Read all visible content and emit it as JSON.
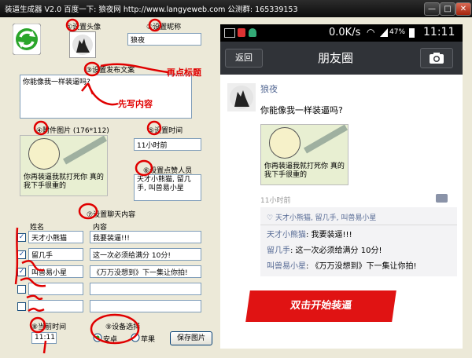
{
  "window": {
    "title": "装逼生成器 V2.0    百度一下: 狼夜网  http://www.langyeweb.com  公测群: 165339153",
    "min_label": "—",
    "max_label": "□",
    "close_label": "✕"
  },
  "left": {
    "avatar_label": "①设置头像",
    "nickname_label": "②设置昵称",
    "nickname_value": "狼夜",
    "post_text_label": "③设置发布文案",
    "post_text_value": "你能像我一样装逼吗?",
    "image_label": "④附件图片 (176*112)",
    "time_label": "⑤设置时间",
    "time_value": "11小时前",
    "likes_label": "⑥设置点赞人员",
    "likes_value": "天才小熊猫, 留几手, 叫兽易小星",
    "comments_label": "⑦设置聊天内容",
    "col_name": "姓名",
    "col_content": "内容",
    "comments": [
      {
        "checked": true,
        "name": "天才小熊猫",
        "content": "我要装逼!!!"
      },
      {
        "checked": true,
        "name": "留几手",
        "content": "这一次必须给满分 10分!"
      },
      {
        "checked": true,
        "name": "叫兽易小星",
        "content": "《万万没想到》下一集让你拍!"
      },
      {
        "checked": false,
        "name": "",
        "content": ""
      },
      {
        "checked": false,
        "name": "",
        "content": ""
      }
    ],
    "current_time_label": "⑧当前时间",
    "current_time_value": "11:11",
    "device_label": "⑨设备选择",
    "device_android": "安卓",
    "device_apple": "苹果",
    "device_selected": "android",
    "save_button": "保存图片"
  },
  "annotations": {
    "click_title": "再点标题",
    "write_content": "先写内容"
  },
  "phone": {
    "speed": "0.0K/s",
    "battery": "47%",
    "clock": "11:11",
    "back": "返回",
    "title": "朋友圈",
    "camera_icon": "camera-icon",
    "nickname": "狼夜",
    "post_text": "你能像我一样装逼吗?",
    "image_caption": "你再装逼我就打死你 真的 我下手很重的",
    "time": "11小时前",
    "likes": "天才小熊猫, 留几手, 叫兽易小星",
    "comments": [
      {
        "name": "天才小熊猫",
        "content": ": 我要装逼!!!"
      },
      {
        "name": "留几手",
        "content": ": 这一次必须给满分 10分!"
      },
      {
        "name": "叫兽易小星",
        "content": ": 《万万没想到》下一集让你拍!"
      }
    ]
  },
  "banner": "双击开始装逼",
  "colors": {
    "wechat_blue": "#576b95",
    "red": "#e00000",
    "titlebar": "#1a1a1a",
    "wechat_bar": "#303338"
  }
}
